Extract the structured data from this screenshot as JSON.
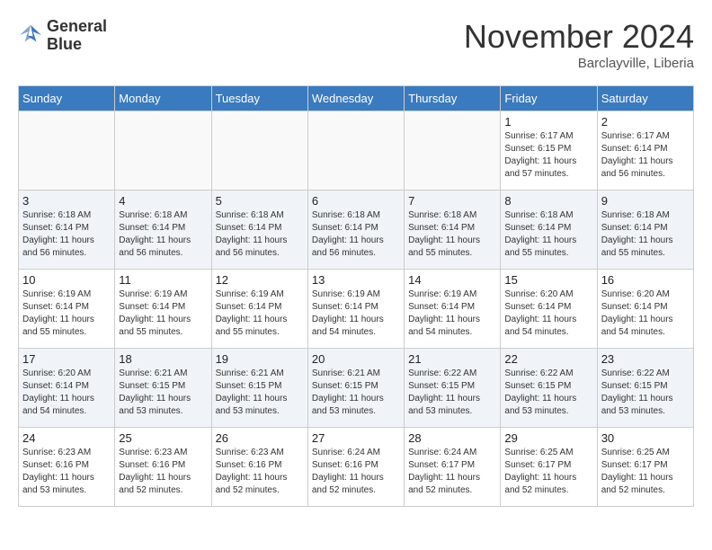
{
  "header": {
    "logo_line1": "General",
    "logo_line2": "Blue",
    "month_title": "November 2024",
    "subtitle": "Barclayville, Liberia"
  },
  "weekdays": [
    "Sunday",
    "Monday",
    "Tuesday",
    "Wednesday",
    "Thursday",
    "Friday",
    "Saturday"
  ],
  "rows": [
    [
      {
        "day": "",
        "info": ""
      },
      {
        "day": "",
        "info": ""
      },
      {
        "day": "",
        "info": ""
      },
      {
        "day": "",
        "info": ""
      },
      {
        "day": "",
        "info": ""
      },
      {
        "day": "1",
        "info": "Sunrise: 6:17 AM\nSunset: 6:15 PM\nDaylight: 11 hours and 57 minutes."
      },
      {
        "day": "2",
        "info": "Sunrise: 6:17 AM\nSunset: 6:14 PM\nDaylight: 11 hours and 56 minutes."
      }
    ],
    [
      {
        "day": "3",
        "info": "Sunrise: 6:18 AM\nSunset: 6:14 PM\nDaylight: 11 hours and 56 minutes."
      },
      {
        "day": "4",
        "info": "Sunrise: 6:18 AM\nSunset: 6:14 PM\nDaylight: 11 hours and 56 minutes."
      },
      {
        "day": "5",
        "info": "Sunrise: 6:18 AM\nSunset: 6:14 PM\nDaylight: 11 hours and 56 minutes."
      },
      {
        "day": "6",
        "info": "Sunrise: 6:18 AM\nSunset: 6:14 PM\nDaylight: 11 hours and 56 minutes."
      },
      {
        "day": "7",
        "info": "Sunrise: 6:18 AM\nSunset: 6:14 PM\nDaylight: 11 hours and 55 minutes."
      },
      {
        "day": "8",
        "info": "Sunrise: 6:18 AM\nSunset: 6:14 PM\nDaylight: 11 hours and 55 minutes."
      },
      {
        "day": "9",
        "info": "Sunrise: 6:18 AM\nSunset: 6:14 PM\nDaylight: 11 hours and 55 minutes."
      }
    ],
    [
      {
        "day": "10",
        "info": "Sunrise: 6:19 AM\nSunset: 6:14 PM\nDaylight: 11 hours and 55 minutes."
      },
      {
        "day": "11",
        "info": "Sunrise: 6:19 AM\nSunset: 6:14 PM\nDaylight: 11 hours and 55 minutes."
      },
      {
        "day": "12",
        "info": "Sunrise: 6:19 AM\nSunset: 6:14 PM\nDaylight: 11 hours and 55 minutes."
      },
      {
        "day": "13",
        "info": "Sunrise: 6:19 AM\nSunset: 6:14 PM\nDaylight: 11 hours and 54 minutes."
      },
      {
        "day": "14",
        "info": "Sunrise: 6:19 AM\nSunset: 6:14 PM\nDaylight: 11 hours and 54 minutes."
      },
      {
        "day": "15",
        "info": "Sunrise: 6:20 AM\nSunset: 6:14 PM\nDaylight: 11 hours and 54 minutes."
      },
      {
        "day": "16",
        "info": "Sunrise: 6:20 AM\nSunset: 6:14 PM\nDaylight: 11 hours and 54 minutes."
      }
    ],
    [
      {
        "day": "17",
        "info": "Sunrise: 6:20 AM\nSunset: 6:14 PM\nDaylight: 11 hours and 54 minutes."
      },
      {
        "day": "18",
        "info": "Sunrise: 6:21 AM\nSunset: 6:15 PM\nDaylight: 11 hours and 53 minutes."
      },
      {
        "day": "19",
        "info": "Sunrise: 6:21 AM\nSunset: 6:15 PM\nDaylight: 11 hours and 53 minutes."
      },
      {
        "day": "20",
        "info": "Sunrise: 6:21 AM\nSunset: 6:15 PM\nDaylight: 11 hours and 53 minutes."
      },
      {
        "day": "21",
        "info": "Sunrise: 6:22 AM\nSunset: 6:15 PM\nDaylight: 11 hours and 53 minutes."
      },
      {
        "day": "22",
        "info": "Sunrise: 6:22 AM\nSunset: 6:15 PM\nDaylight: 11 hours and 53 minutes."
      },
      {
        "day": "23",
        "info": "Sunrise: 6:22 AM\nSunset: 6:15 PM\nDaylight: 11 hours and 53 minutes."
      }
    ],
    [
      {
        "day": "24",
        "info": "Sunrise: 6:23 AM\nSunset: 6:16 PM\nDaylight: 11 hours and 53 minutes."
      },
      {
        "day": "25",
        "info": "Sunrise: 6:23 AM\nSunset: 6:16 PM\nDaylight: 11 hours and 52 minutes."
      },
      {
        "day": "26",
        "info": "Sunrise: 6:23 AM\nSunset: 6:16 PM\nDaylight: 11 hours and 52 minutes."
      },
      {
        "day": "27",
        "info": "Sunrise: 6:24 AM\nSunset: 6:16 PM\nDaylight: 11 hours and 52 minutes."
      },
      {
        "day": "28",
        "info": "Sunrise: 6:24 AM\nSunset: 6:17 PM\nDaylight: 11 hours and 52 minutes."
      },
      {
        "day": "29",
        "info": "Sunrise: 6:25 AM\nSunset: 6:17 PM\nDaylight: 11 hours and 52 minutes."
      },
      {
        "day": "30",
        "info": "Sunrise: 6:25 AM\nSunset: 6:17 PM\nDaylight: 11 hours and 52 minutes."
      }
    ]
  ]
}
